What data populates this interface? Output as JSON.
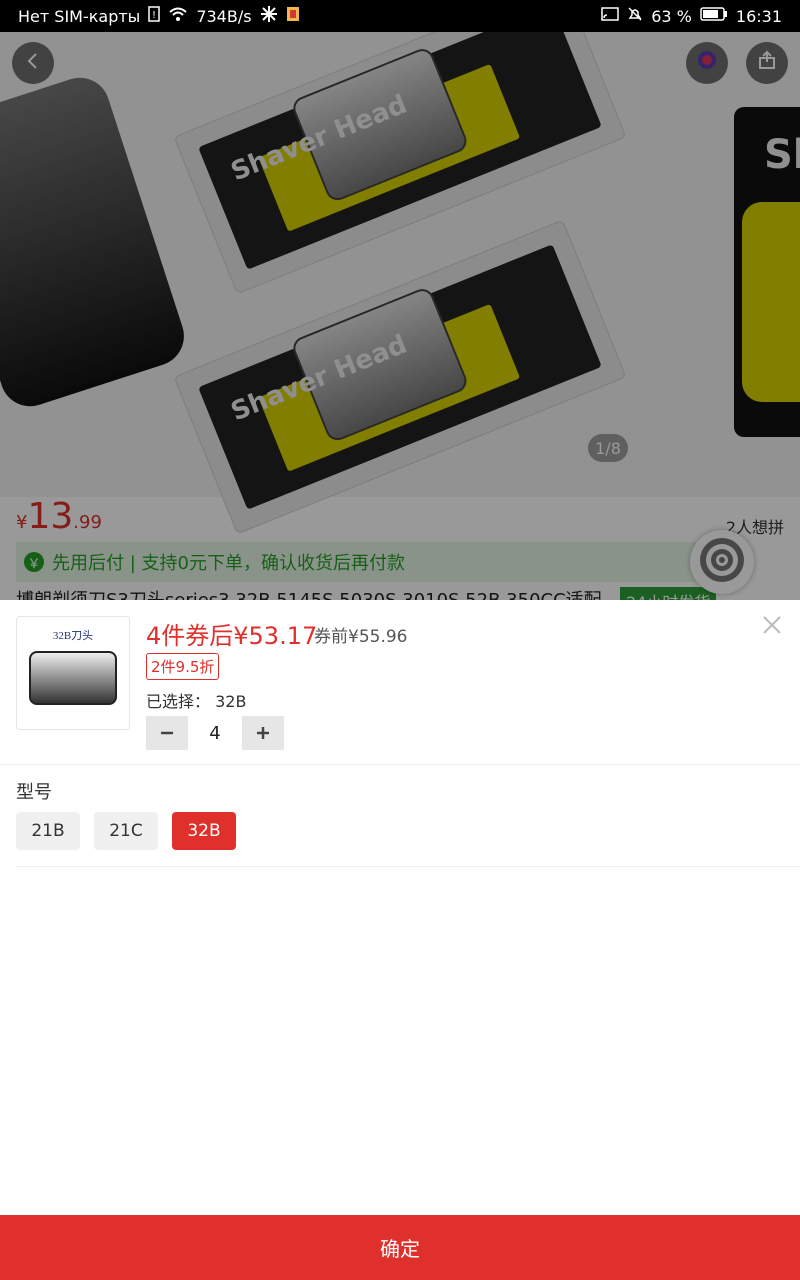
{
  "status_bar": {
    "carrier": "Нет SIM-карты",
    "speed": "734B/s",
    "battery": "63 %",
    "time": "16:31"
  },
  "background_page": {
    "pager": "1/8",
    "price": {
      "symbol": "¥",
      "main": "13",
      "decimal": ".99"
    },
    "wants": "2人想拼",
    "paylater": "先用后付 | 支持0元下单，确认收货后再付款",
    "title": "博朗剃须刀S3刀头series3 32B 5145S 5030S 3010S 52B 350CC适配",
    "badge": "24小时发货",
    "pack_text": "Shaver Head",
    "right_pack_text": "Sh"
  },
  "sheet": {
    "thumb_caption": "32B刀头",
    "after_coupon_price": "4件券后¥53.17",
    "before_coupon_price": "券前¥55.96",
    "promo": "2件9.5折",
    "selected_label": "已选择：",
    "selected_value": "32B",
    "quantity": "4",
    "section_title": "型号",
    "options": [
      "21B",
      "21C",
      "32B"
    ],
    "selected_option": "32B",
    "confirm_label": "确定"
  },
  "icons": {
    "back": "back-icon",
    "share": "share-icon",
    "close": "close-icon",
    "minus": "minus-icon",
    "plus": "plus-icon"
  },
  "colors": {
    "accent": "#e0302b",
    "green": "#26a126",
    "sheet_bg": "#ffffff"
  }
}
